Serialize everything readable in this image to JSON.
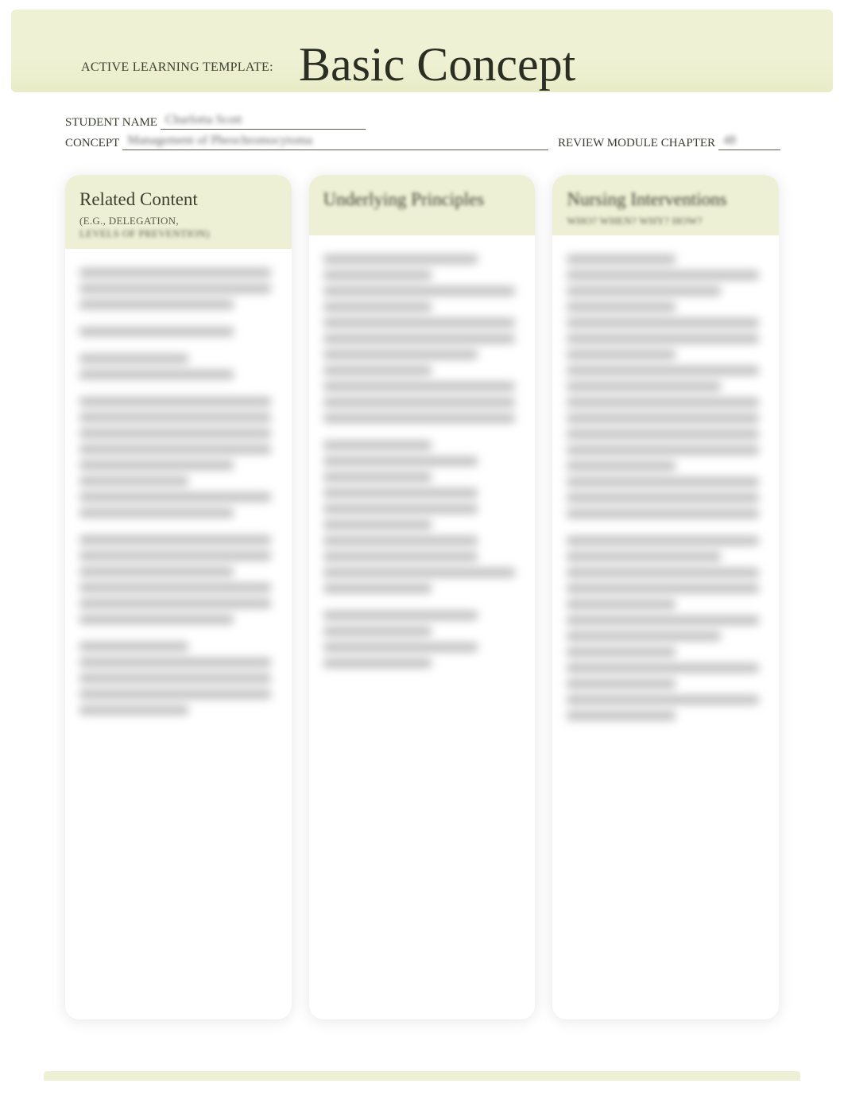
{
  "header": {
    "small": "ACTIVE LEARNING TEMPLATE:",
    "big": "Basic Concept"
  },
  "fields": {
    "student_label": "STUDENT NAME",
    "student_value": "Charlotta Scott",
    "concept_label": "CONCEPT",
    "concept_value": "Management of Pheochromocytoma",
    "chapter_label": "REVIEW MODULE CHAPTER",
    "chapter_value": "48"
  },
  "cards": [
    {
      "title": "Related Content",
      "subtitle_line1": "(E.G., DELEGATION,",
      "subtitle_line2": "LEVELS OF PREVENTION)"
    },
    {
      "title": "Underlying Principles",
      "subtitle_line1": "",
      "subtitle_line2": ""
    },
    {
      "title": "Nursing Interventions",
      "subtitle_line1": "WHO? WHEN? WHY? HOW?",
      "subtitle_line2": ""
    }
  ]
}
